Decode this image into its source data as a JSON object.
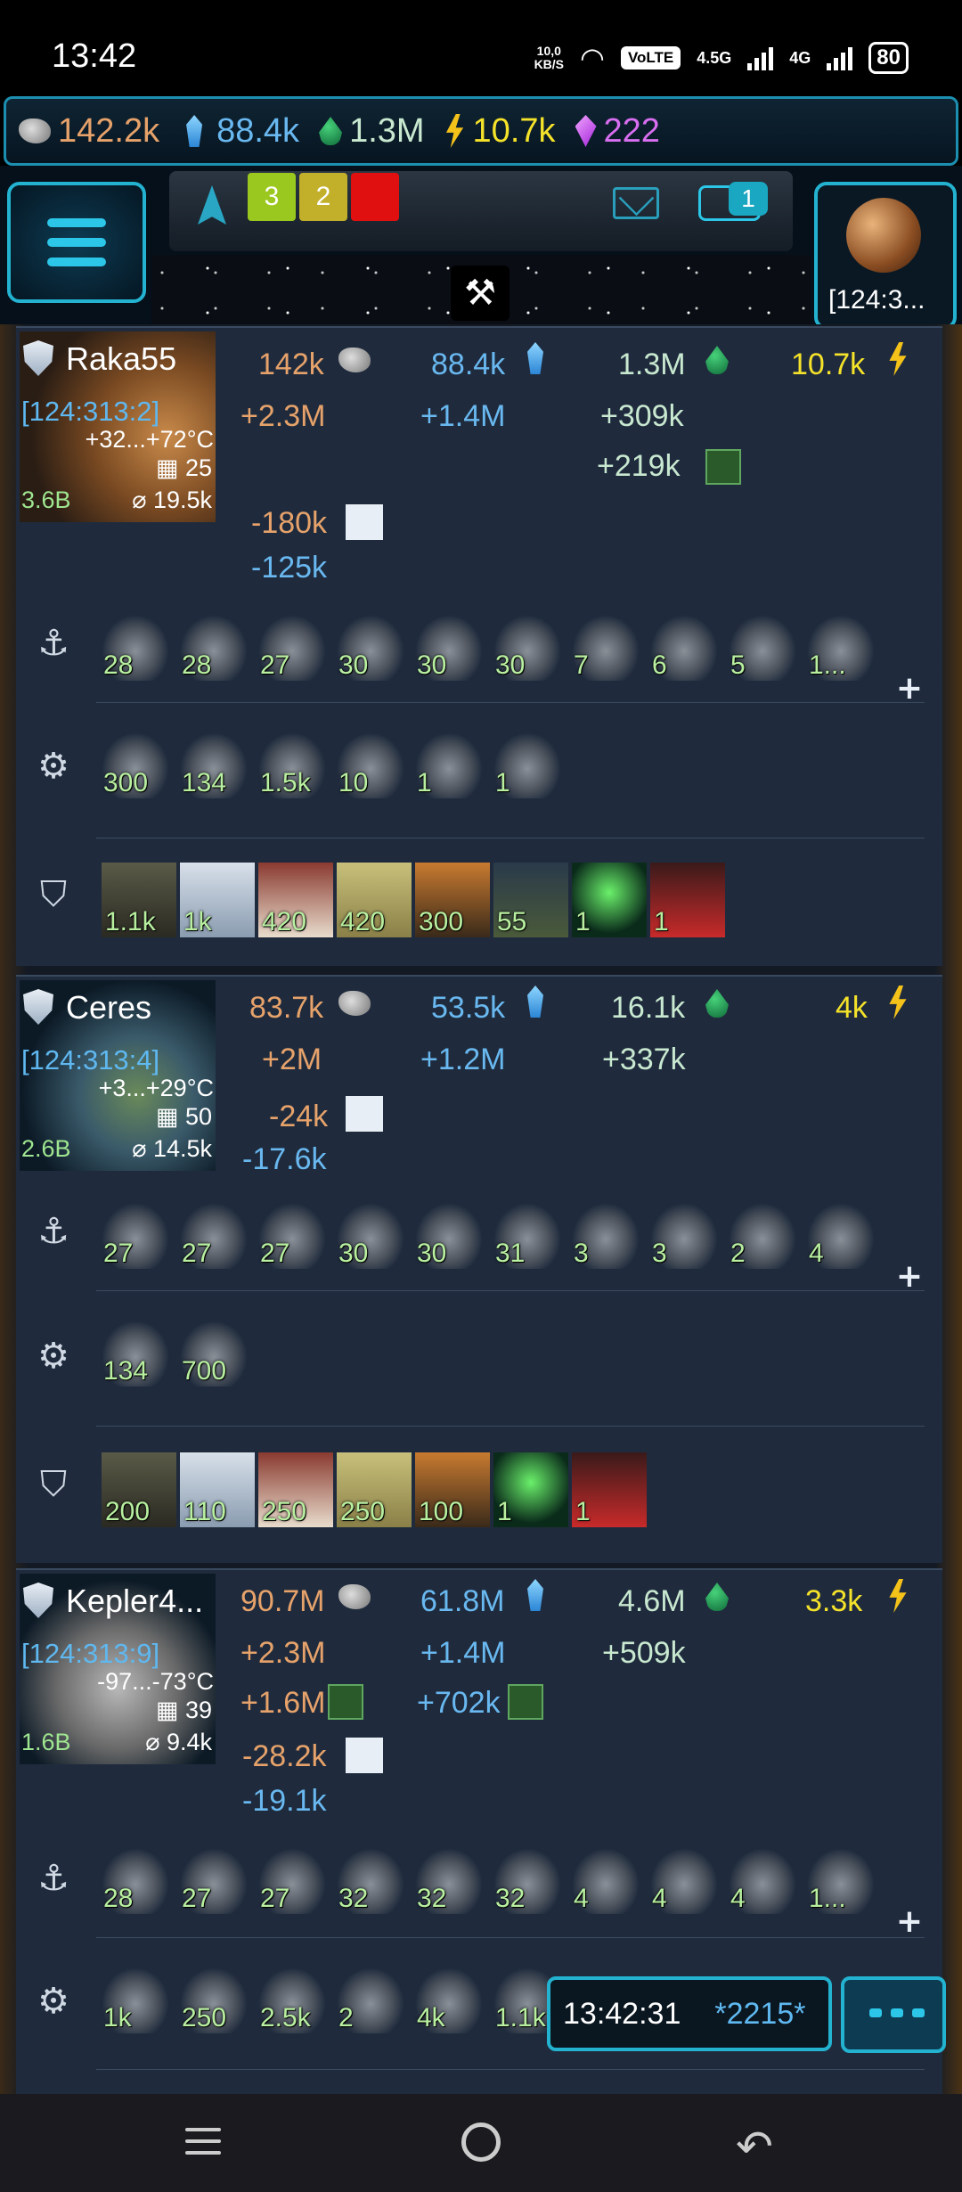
{
  "status_bar": {
    "time": "13:42",
    "net_speed": "10,0",
    "net_unit": "KB/S",
    "volte": "VoLTE",
    "sim1": "1",
    "sim2": "2",
    "net1": "4.5G",
    "net2": "4G",
    "battery": "80"
  },
  "resources": {
    "metal": "142.2k",
    "crystal": "88.4k",
    "deuterium": "1.3M",
    "energy": "10.7k",
    "gems": "222"
  },
  "header": {
    "badges": [
      "3",
      "2",
      ""
    ],
    "chat_count": "1",
    "current_planet_coord": "[124:3..."
  },
  "planets": [
    {
      "name": "Raka55",
      "coord": "[124:313:2]",
      "temp": "+32...+72°C",
      "fields": "25",
      "population": "3.6B",
      "area": "⌀ 19.5k",
      "metal": "142k",
      "crystal": "88.4k",
      "deuterium": "1.3M",
      "energy": "10.7k",
      "metal_prod": "+2.3M",
      "crystal_prod": "+1.4M",
      "deut_prod": "+309k",
      "deut_bonus": "+219k",
      "metal_loss": "-180k",
      "crystal_loss": "-125k",
      "ships": [
        "28",
        "28",
        "27",
        "30",
        "30",
        "30",
        "7",
        "6",
        "5",
        "1..."
      ],
      "fleet": [
        "300",
        "134",
        "1.5k",
        "10",
        "1",
        "1"
      ],
      "defense": [
        "1.1k",
        "1k",
        "420",
        "420",
        "300",
        "55",
        "1",
        "1"
      ]
    },
    {
      "name": "Ceres",
      "coord": "[124:313:4]",
      "temp": "+3...+29°C",
      "fields": "50",
      "population": "2.6B",
      "area": "⌀ 14.5k",
      "metal": "83.7k",
      "crystal": "53.5k",
      "deuterium": "16.1k",
      "energy": "4k",
      "metal_prod": "+2M",
      "crystal_prod": "+1.2M",
      "deut_prod": "+337k",
      "metal_loss": "-24k",
      "crystal_loss": "-17.6k",
      "ships": [
        "27",
        "27",
        "27",
        "30",
        "30",
        "31",
        "3",
        "3",
        "2",
        "4"
      ],
      "fleet": [
        "134",
        "700"
      ],
      "defense": [
        "200",
        "110",
        "250",
        "250",
        "100",
        "1",
        "1"
      ]
    },
    {
      "name": "Kepler4...",
      "coord": "[124:313:9]",
      "temp": "-97...-73°C",
      "fields": "39",
      "population": "1.6B",
      "area": "⌀ 9.4k",
      "metal": "90.7M",
      "crystal": "61.8M",
      "deuterium": "4.6M",
      "energy": "3.3k",
      "metal_prod": "+2.3M",
      "crystal_prod": "+1.4M",
      "deut_prod": "+509k",
      "metal_bonus": "+1.6M",
      "crystal_bonus": "+702k",
      "metal_loss": "-28.2k",
      "crystal_loss": "-19.1k",
      "ships": [
        "28",
        "27",
        "27",
        "32",
        "32",
        "32",
        "4",
        "4",
        "4",
        "1..."
      ],
      "fleet": [
        "1k",
        "250",
        "2.5k",
        "2",
        "4k",
        "1.1k"
      ]
    }
  ],
  "clock": {
    "time": "13:42:31",
    "code": "*2215*"
  },
  "colors": {
    "accent": "#23b2d0",
    "metal": "#e6a26a",
    "crystal": "#69b8f0",
    "energy": "#f5e22a",
    "gems": "#d86ef0"
  }
}
